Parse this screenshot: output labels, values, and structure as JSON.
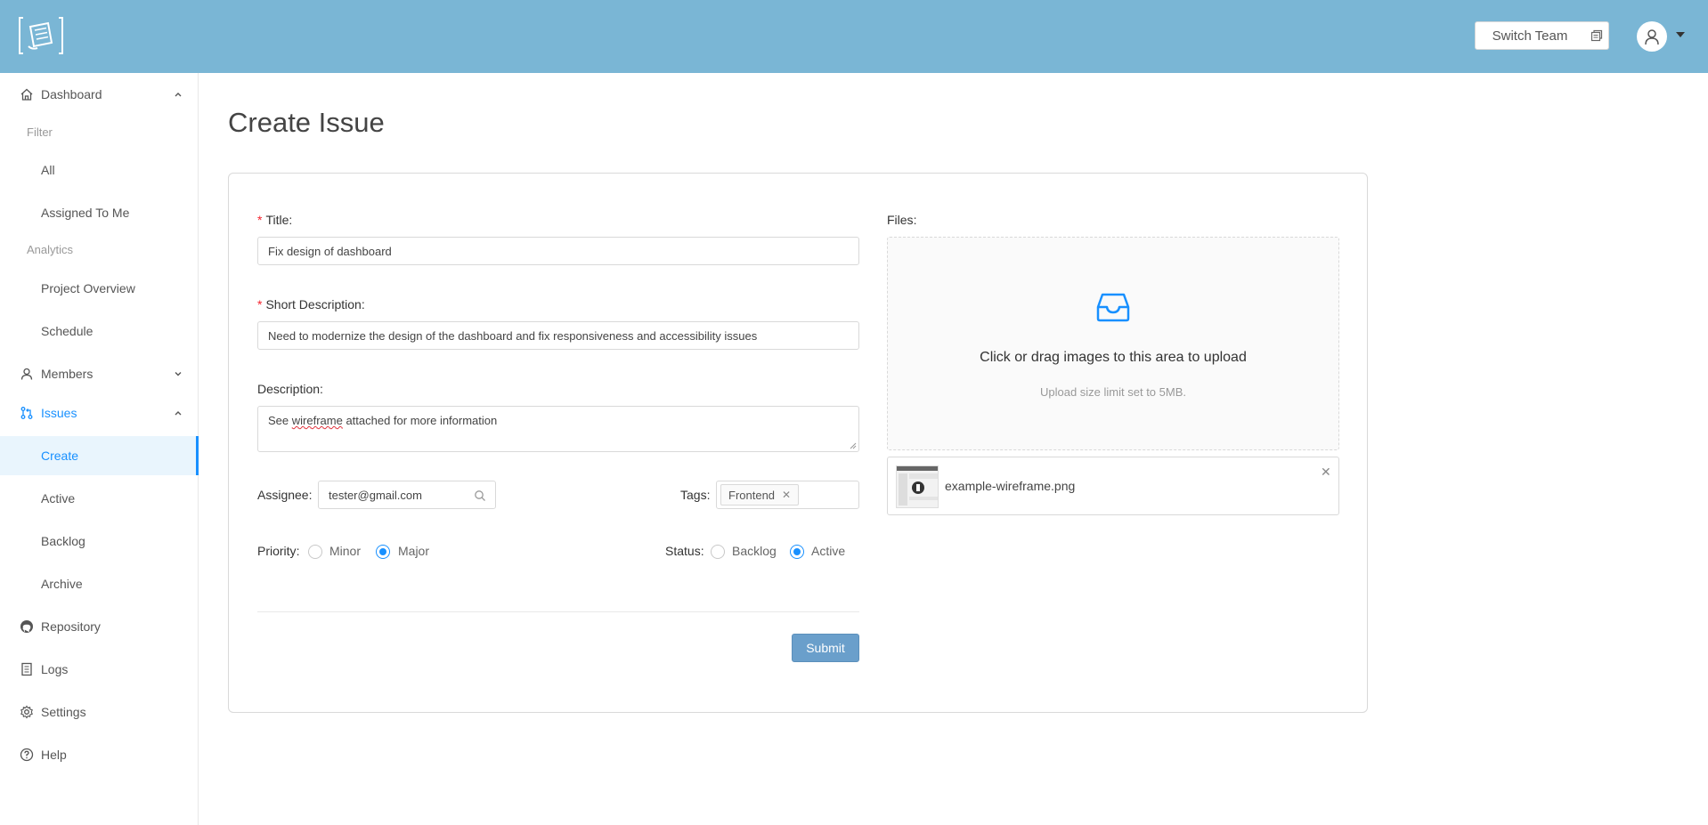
{
  "header": {
    "switch_team_label": "Switch Team",
    "brand_color": "#7ab6d5"
  },
  "sidebar": {
    "dashboard": "Dashboard",
    "filter_group": "Filter",
    "all": "All",
    "assigned_to_me": "Assigned To Me",
    "analytics_group": "Analytics",
    "project_overview": "Project Overview",
    "schedule": "Schedule",
    "members": "Members",
    "issues": "Issues",
    "create": "Create",
    "active": "Active",
    "backlog": "Backlog",
    "archive": "Archive",
    "repository": "Repository",
    "logs": "Logs",
    "settings": "Settings",
    "help": "Help",
    "accent_color": "#1890ff"
  },
  "main": {
    "page_title": "Create Issue"
  },
  "form": {
    "title_label": "Title",
    "title_value": "Fix design of dashboard",
    "short_desc_label": "Short Description",
    "short_desc_value": "Need to modernize the design of the dashboard and fix responsiveness and accessibility issues",
    "description_label": "Description",
    "description_before": "See ",
    "description_misspelled": "wireframe",
    "description_after": " attached for more information",
    "assignee_label": "Assignee",
    "assignee_value": "tester@gmail.com",
    "tags_label": "Tags",
    "tags": [
      "Frontend"
    ],
    "priority_label": "Priority",
    "priority_options": [
      "Minor",
      "Major"
    ],
    "priority_selected": "Major",
    "status_label": "Status",
    "status_options": [
      "Backlog",
      "Active"
    ],
    "status_selected": "Active",
    "submit_label": "Submit"
  },
  "files": {
    "label": "Files",
    "drop_text": "Click or drag images to this area to upload",
    "drop_hint": "Upload size limit set to 5MB.",
    "uploaded": [
      {
        "name": "example-wireframe.png"
      }
    ]
  }
}
